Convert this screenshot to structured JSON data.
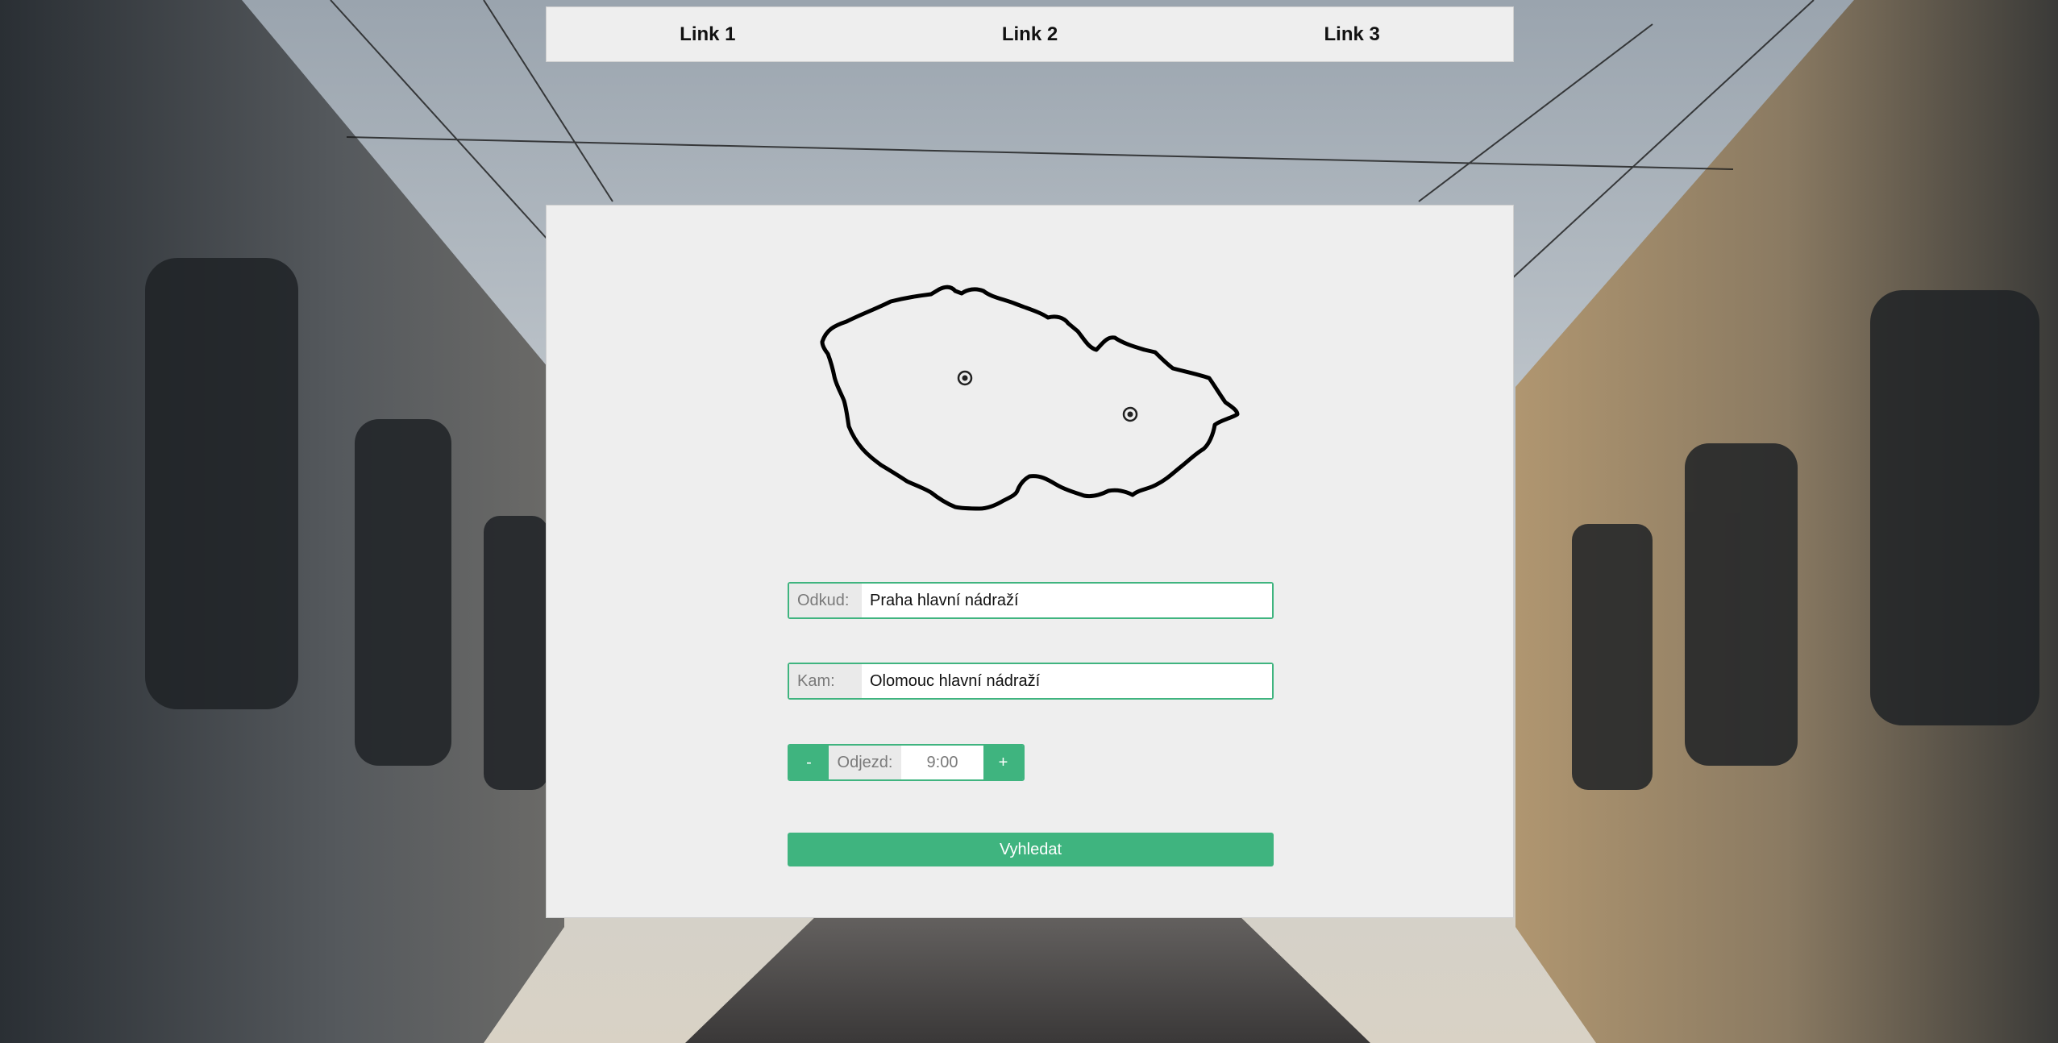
{
  "nav": {
    "links": [
      "Link 1",
      "Link 2",
      "Link 3"
    ]
  },
  "form": {
    "from": {
      "label": "Odkud:",
      "value": "Praha hlavní nádraží"
    },
    "to": {
      "label": "Kam:",
      "value": "Olomouc hlavní nádraží"
    },
    "departure": {
      "minus_label": "-",
      "label": "Odjezd:",
      "value": "9:00",
      "plus_label": "+"
    },
    "search_label": "Vyhledat"
  },
  "icons": {
    "map": "czech-republic-outline-map",
    "markers": [
      "praha-marker",
      "olomouc-marker"
    ],
    "background": "train-station-photo"
  },
  "colors": {
    "accent": "#3fb47f",
    "panel": "#eeeeee"
  }
}
